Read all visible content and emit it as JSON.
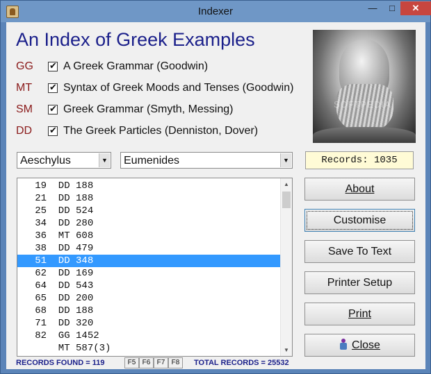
{
  "window": {
    "title": "Indexer"
  },
  "heading": "An Index of Greek Examples",
  "sources": [
    {
      "code": "GG",
      "label": "A Greek Grammar (Goodwin)"
    },
    {
      "code": "MT",
      "label": "Syntax of Greek Moods and Tenses (Goodwin)"
    },
    {
      "code": "SM",
      "label": "Greek Grammar (Smyth, Messing)"
    },
    {
      "code": "DD",
      "label": "The Greek Particles (Denniston, Dover)"
    }
  ],
  "portrait_watermark": "SOFTPEDIA",
  "author_select": "Aeschylus",
  "work_select": "Eumenides",
  "records_label": "Records: 1035",
  "list": [
    "   19  DD 188",
    "   21  DD 188",
    "   25  DD 524",
    "   34  DD 280",
    "   36  MT 608",
    "   38  DD 479",
    "   51  DD 348",
    "   62  DD 169",
    "   64  DD 543",
    "   65  DD 200",
    "   68  DD 188",
    "   71  DD 320",
    "   82  GG 1452",
    "       MT 587(3)"
  ],
  "selected_row": 6,
  "buttons": {
    "about": "About",
    "customise": "Customise",
    "save": "Save To Text",
    "printer_setup": "Printer Setup",
    "print": "Print",
    "close": "Close"
  },
  "status": {
    "found": "RECORDS FOUND = 119",
    "fkeys": [
      "F5",
      "F6",
      "F7",
      "F8"
    ],
    "total": "TOTAL RECORDS = 25532"
  }
}
